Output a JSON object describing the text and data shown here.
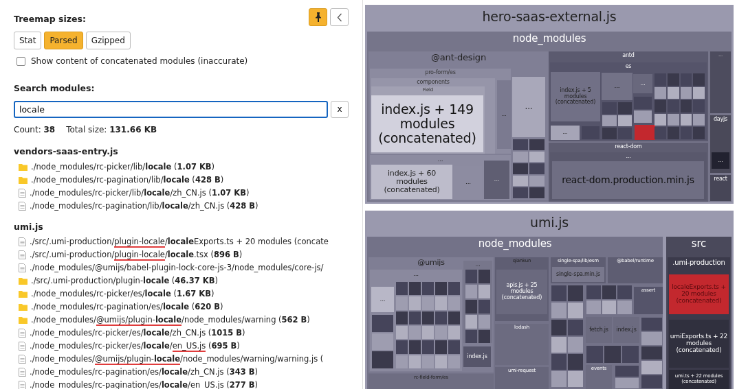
{
  "sidebar": {
    "pinned": true,
    "sizes_title": "Treemap sizes:",
    "size_options": [
      {
        "label": "Stat",
        "selected": false
      },
      {
        "label": "Parsed",
        "selected": true
      },
      {
        "label": "Gzipped",
        "selected": false
      }
    ],
    "concatenated_option": {
      "label": "Show content of concatenated modules (inaccurate)",
      "checked": false
    },
    "search_title": "Search modules:",
    "search": {
      "value": "locale",
      "clear": "x"
    },
    "stats": [
      {
        "label": "Count:",
        "value": "38"
      },
      {
        "label": "Total size:",
        "value": "131.66 KB"
      }
    ],
    "groups": [
      {
        "title": "vendors-saas-entry.js",
        "items": [
          {
            "kind": "folder",
            "segments": [
              {
                "text": "./node_modules/rc-picker/lib/"
              },
              {
                "text": "locale",
                "bold": true
              },
              {
                "text": " ("
              },
              {
                "text": "1.07 KB",
                "bold": true
              },
              {
                "text": ")"
              }
            ]
          },
          {
            "kind": "folder",
            "segments": [
              {
                "text": "./node_modules/rc-pagination/lib/"
              },
              {
                "text": "locale",
                "bold": true
              },
              {
                "text": " ("
              },
              {
                "text": "428 B",
                "bold": true
              },
              {
                "text": ")"
              }
            ]
          },
          {
            "kind": "file",
            "segments": [
              {
                "text": "./node_modules/rc-picker/lib/"
              },
              {
                "text": "locale",
                "bold": true
              },
              {
                "text": "/zh_CN.js ("
              },
              {
                "text": "1.07 KB",
                "bold": true
              },
              {
                "text": ")"
              }
            ]
          },
          {
            "kind": "file",
            "segments": [
              {
                "text": "./node_modules/rc-pagination/lib/"
              },
              {
                "text": "locale",
                "bold": true
              },
              {
                "text": "/zh_CN.js ("
              },
              {
                "text": "428 B",
                "bold": true
              },
              {
                "text": ")"
              }
            ]
          }
        ]
      },
      {
        "title": "umi.js",
        "items": [
          {
            "kind": "file",
            "segments": [
              {
                "text": "./src/.umi-production/"
              },
              {
                "text": "plugin-locale",
                "underlined": true
              },
              {
                "text": "/"
              },
              {
                "text": "locale",
                "bold": true
              },
              {
                "text": "Exports.ts + 20 modules (concate"
              }
            ]
          },
          {
            "kind": "file",
            "segments": [
              {
                "text": "./src/.umi-production/"
              },
              {
                "text": "plugin-locale",
                "underlined": true
              },
              {
                "text": "/"
              },
              {
                "text": "locale",
                "bold": true
              },
              {
                "text": ".tsx ("
              },
              {
                "text": "896 B",
                "bold": true
              },
              {
                "text": ")"
              }
            ]
          },
          {
            "kind": "file",
            "segments": [
              {
                "text": "./node_modules/@umijs/babel-plugin-lock-core-js-3/node_modules/core-js/"
              }
            ]
          },
          {
            "kind": "folder",
            "segments": [
              {
                "text": "./src/.umi-production/plugin-"
              },
              {
                "text": "locale",
                "bold": true
              },
              {
                "text": " ("
              },
              {
                "text": "46.37 KB",
                "bold": true
              },
              {
                "text": ")"
              }
            ]
          },
          {
            "kind": "folder",
            "segments": [
              {
                "text": "./node_modules/rc-picker/es/"
              },
              {
                "text": "locale",
                "bold": true
              },
              {
                "text": " ("
              },
              {
                "text": "1.67 KB",
                "bold": true
              },
              {
                "text": ")"
              }
            ]
          },
          {
            "kind": "folder",
            "segments": [
              {
                "text": "./node_modules/rc-pagination/es/"
              },
              {
                "text": "locale",
                "bold": true
              },
              {
                "text": " ("
              },
              {
                "text": "620 B",
                "bold": true
              },
              {
                "text": ")"
              }
            ]
          },
          {
            "kind": "folder",
            "segments": [
              {
                "text": "./node_modules/"
              },
              {
                "text": "@umijs/plugin-",
                "underlined": true
              },
              {
                "text": "locale",
                "bold": true,
                "underlined": true
              },
              {
                "text": "/node_modules/warning ("
              },
              {
                "text": "562 B",
                "bold": true
              },
              {
                "text": ")"
              }
            ]
          },
          {
            "kind": "file",
            "segments": [
              {
                "text": "./node_modules/rc-picker/es/"
              },
              {
                "text": "locale",
                "bold": true
              },
              {
                "text": "/zh_CN.js ("
              },
              {
                "text": "1015 B",
                "bold": true
              },
              {
                "text": ")"
              }
            ]
          },
          {
            "kind": "file",
            "segments": [
              {
                "text": "./node_modules/rc-picker/es/"
              },
              {
                "text": "locale",
                "bold": true
              },
              {
                "text": "/"
              },
              {
                "text": "en_US.js",
                "underlined": true
              },
              {
                "text": " ("
              },
              {
                "text": "695 B",
                "bold": true
              },
              {
                "text": ")"
              }
            ]
          },
          {
            "kind": "file",
            "segments": [
              {
                "text": "./node_modules/"
              },
              {
                "text": "@umijs/plugin-",
                "underlined": true
              },
              {
                "text": "locale",
                "bold": true,
                "underlined": true
              },
              {
                "text": "/node_modules/warning/warning.js ("
              }
            ]
          },
          {
            "kind": "file",
            "segments": [
              {
                "text": "./node_modules/rc-pagination/es/"
              },
              {
                "text": "locale",
                "bold": true
              },
              {
                "text": "/zh_CN.js ("
              },
              {
                "text": "343 B",
                "bold": true
              },
              {
                "text": ")"
              }
            ]
          },
          {
            "kind": "file",
            "segments": [
              {
                "text": "./node_modules/rc-pagination/es/"
              },
              {
                "text": "locale",
                "bold": true
              },
              {
                "text": "/"
              },
              {
                "text": "en_US.js",
                "underlined": true
              },
              {
                "text": " ("
              },
              {
                "text": "277 B",
                "bold": true
              },
              {
                "text": ")"
              }
            ]
          }
        ]
      }
    ]
  },
  "treemap": {
    "bundles": [
      {
        "label": "hero-saas-external.js",
        "cells": [
          {
            "label": "node_modules",
            "matched": false
          },
          {
            "label": "@ant-design",
            "matched": false
          },
          {
            "label": "pro-form/es",
            "matched": false
          },
          {
            "label": "components",
            "matched": false
          },
          {
            "label": "Field",
            "matched": false
          },
          {
            "label": "index.js + 149 modules (concatenated)",
            "matched": false
          },
          {
            "label": "...",
            "matched": false
          },
          {
            "label": "index.js + 60 modules (concatenated)",
            "matched": false
          },
          {
            "label": "...",
            "matched": false
          },
          {
            "label": "...",
            "matched": false
          },
          {
            "label": "...",
            "matched": false
          },
          {
            "label": "...",
            "matched": false
          },
          {
            "label": "antd",
            "matched": false
          },
          {
            "label": "es",
            "matched": false
          },
          {
            "label": "index.js + 5 modules (concatenated)",
            "matched": false
          },
          {
            "label": "...",
            "matched": false
          },
          {
            "label": "...",
            "matched": false
          },
          {
            "matched": true
          },
          {
            "label": "...",
            "matched": false
          },
          {
            "label": "react-dom",
            "matched": false
          },
          {
            "label": "...",
            "matched": false
          },
          {
            "label": "react-dom.production.min.js",
            "matched": false
          },
          {
            "label": "...",
            "matched": false
          },
          {
            "label": "dayjs",
            "matched": false
          },
          {
            "label": "...",
            "matched": false
          },
          {
            "label": "react",
            "matched": false
          }
        ]
      },
      {
        "label": "umi.js",
        "cells": [
          {
            "label": "node_modules",
            "matched": false
          },
          {
            "label": "src",
            "matched": false
          },
          {
            "label": "@umijs",
            "matched": false
          },
          {
            "label": "...",
            "matched": false
          },
          {
            "label": "...",
            "matched": false
          },
          {
            "label": "...",
            "matched": false
          },
          {
            "label": "index.js",
            "matched": false
          },
          {
            "label": "qiankun",
            "matched": false
          },
          {
            "label": "apis.js + 25 modules (concatenated)",
            "matched": false
          },
          {
            "label": "single-spa/lib/esm",
            "matched": false
          },
          {
            "label": "single-spa.min.js",
            "matched": false
          },
          {
            "label": "@babel/runtime",
            "matched": false
          },
          {
            "label": "assert",
            "matched": false
          },
          {
            "label": "lodash",
            "matched": false
          },
          {
            "label": "fetch.js",
            "matched": false
          },
          {
            "label": "index.js",
            "matched": false
          },
          {
            "label": "umi-request",
            "matched": false
          },
          {
            "label": "events",
            "matched": false
          },
          {
            "label": "rc-field-form/es",
            "matched": false
          },
          {
            "label": ".umi-production",
            "matched": false
          },
          {
            "label": "localeExports.ts + 20 modules (concatenated)",
            "matched": true
          },
          {
            "label": "umiExports.ts + 22 modules (concatenated)",
            "matched": false
          },
          {
            "label": "umi.ts + 22 modules (concatenated)",
            "matched": false
          }
        ]
      }
    ]
  }
}
